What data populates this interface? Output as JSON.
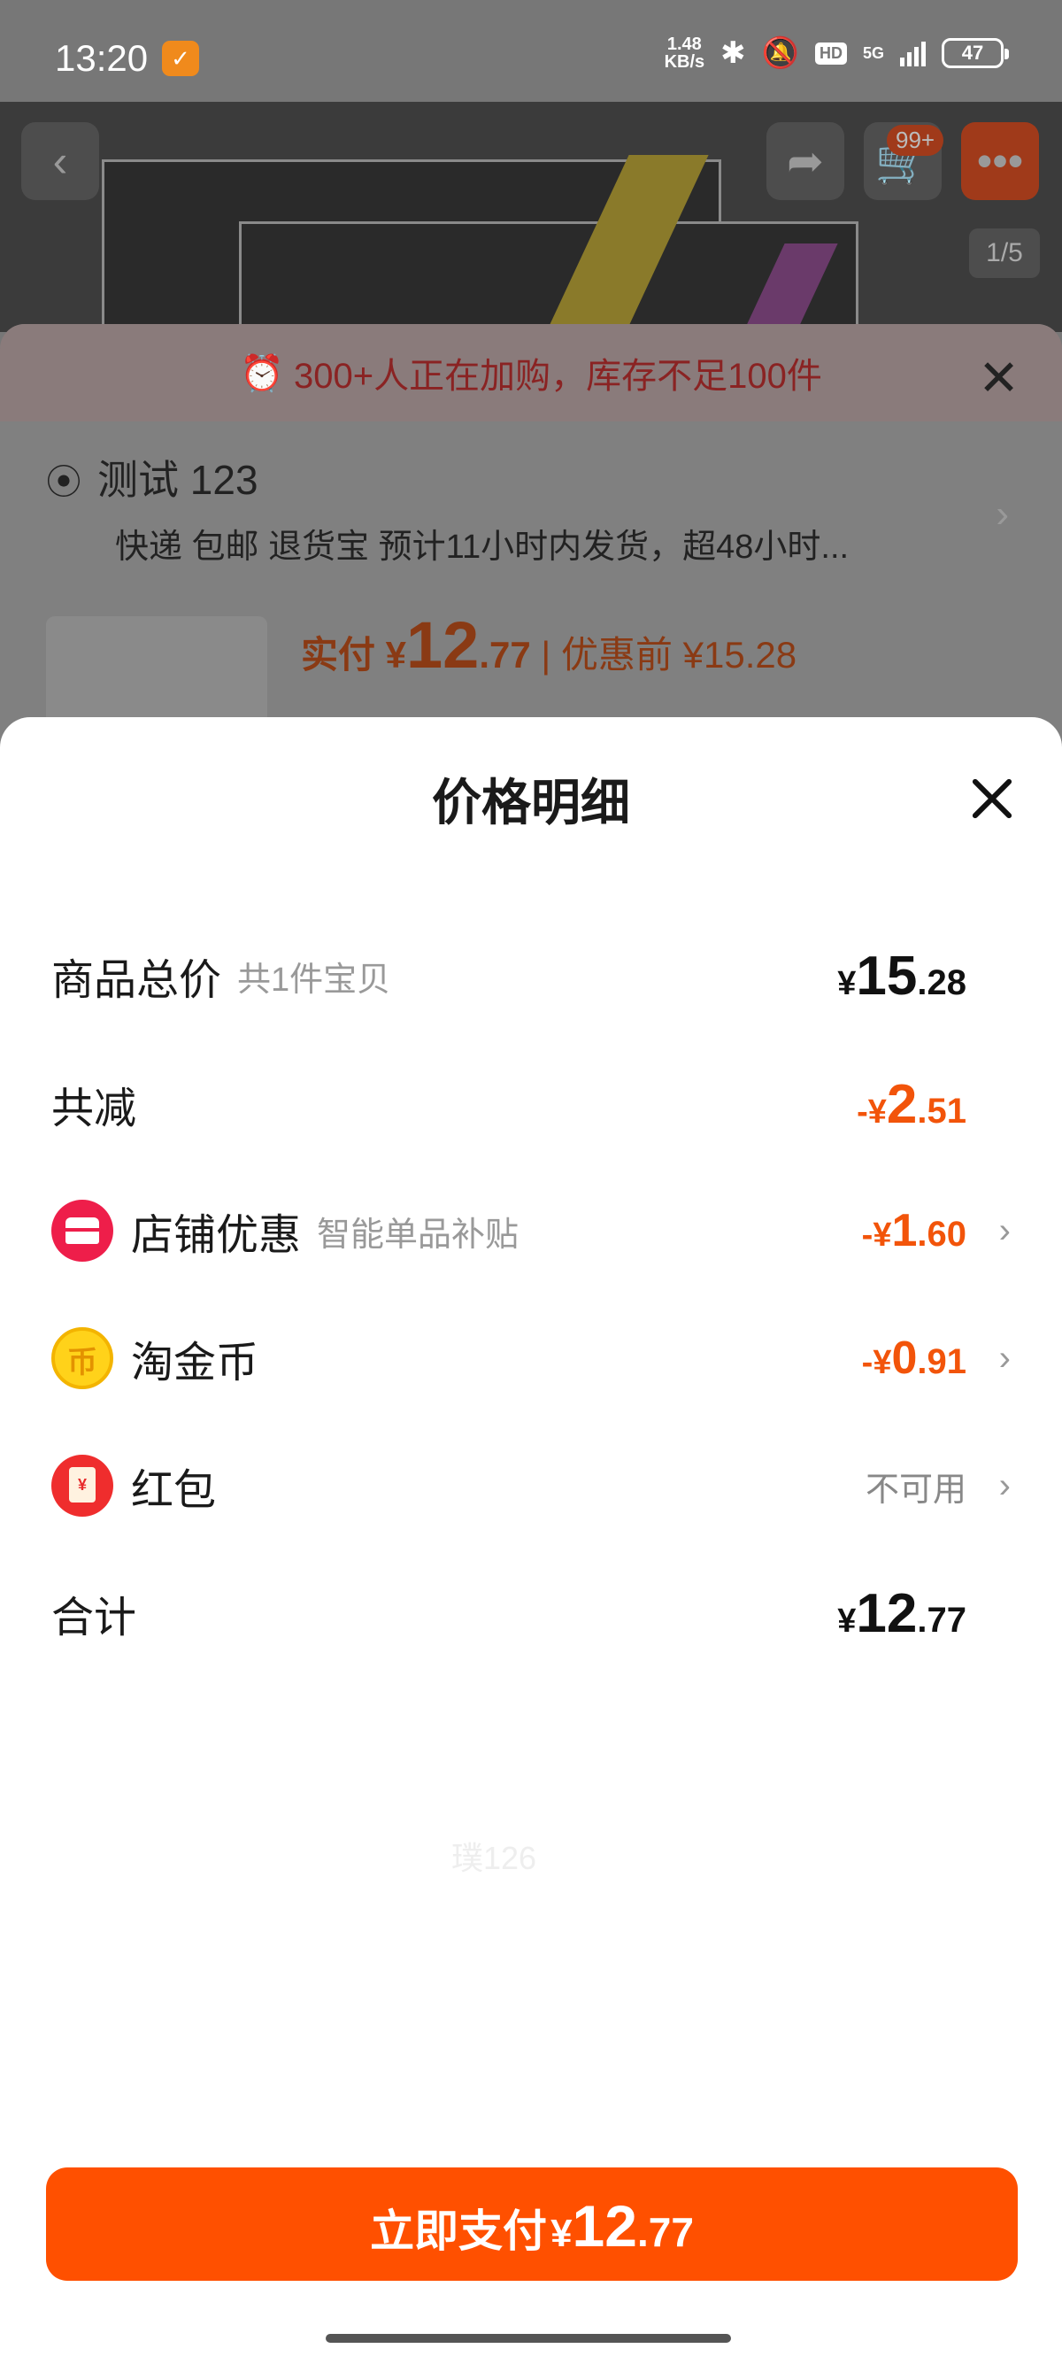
{
  "status_bar": {
    "time": "13:20",
    "app_icon": "app-badge-icon",
    "net_speed_value": "1.48",
    "net_speed_unit": "KB/s",
    "icons": [
      "bluetooth-icon",
      "mute-icon",
      "hd-icon",
      "5g-signal-icon",
      "battery-icon"
    ],
    "hd_label": "HD",
    "network": "5G",
    "battery": "47"
  },
  "background": {
    "cart_badge": "99+",
    "image_pager": "1/5",
    "stock_alert": "300+人正在加购，库存不足100件",
    "address_name": "测试 123",
    "address_sub": "快递 包邮 退货宝 预计11小时内发货，超48小时...",
    "pay_label": "实付 ¥",
    "pay_int": "12",
    "pay_dec": ".77",
    "before_discount": "| 优惠前 ¥15.28"
  },
  "sheet": {
    "title": "价格明细",
    "rows": [
      {
        "label": "商品总价",
        "sub": "共1件宝贝",
        "symbol": "¥",
        "int": "15",
        "dec": ".28"
      },
      {
        "label": "共减",
        "symbol": "-¥",
        "int": "2",
        "dec": ".51"
      },
      {
        "label": "店铺优惠",
        "sub": "智能单品补贴",
        "icon": "shop-icon",
        "symbol": "-¥",
        "int": "1",
        "dec": ".60"
      },
      {
        "label": "淘金币",
        "icon": "coin-icon",
        "icon_glyph": "币",
        "symbol": "-¥",
        "int": "0",
        "dec": ".91"
      },
      {
        "label": "红包",
        "icon": "red-envelope-icon",
        "icon_glyph": "¥",
        "status": "不可用"
      },
      {
        "label": "合计",
        "symbol": "¥",
        "int": "12",
        "dec": ".77"
      }
    ],
    "watermark": "璞126"
  },
  "pay_button": {
    "label": "立即支付",
    "symbol": "¥",
    "int": "12",
    "dec": ".77"
  },
  "colors": {
    "accent": "#ff5000",
    "discount": "#f2540a"
  }
}
